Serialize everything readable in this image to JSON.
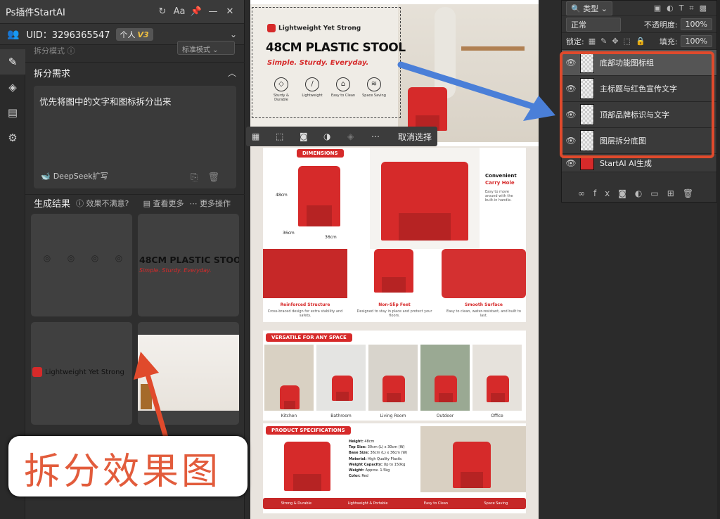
{
  "plugin": {
    "title": "Ps插件StartAI",
    "uid_label": "UID：3296365547",
    "plan": "个人",
    "version": "V3",
    "mode_label": "拆分模式",
    "mode_value": "标准模式",
    "req_section": "拆分需求",
    "req_text": "优先将图中的文字和图标拆分出来",
    "deepseek": "DeepSeek扩写",
    "result_title": "生成结果",
    "unsatisfied": "效果不满意?",
    "view_more": "查看更多",
    "more_ops": "更多操作",
    "tile_headline": "48CM PLASTIC STOOL",
    "tile_subline": "Simple. Sturdy. Everyday.",
    "tile_brand": "Lightweight Yet Strong"
  },
  "annotation": "拆分效果图",
  "canvas": {
    "brand": "Lightweight Yet Strong",
    "headline": "48CM PLASTIC STOOL",
    "subline": "Simple. Sturdy. Everyday.",
    "features": [
      "Sturdy & Durable",
      "Lightweight",
      "Easy to Clean",
      "Space Saving"
    ],
    "toolbar_label": "取消选择",
    "dimensions": "DIMENSIONS",
    "dim_h": "48cm",
    "dim_w1": "36cm",
    "dim_w2": "36cm",
    "convenient": "Convenient",
    "carry": "Carry Hole",
    "carry_desc": "Easy to move around with the built-in handle.",
    "f1_title": "Reinforced Structure",
    "f1_desc": "Cross-braced design for extra stability and safety.",
    "f2_title": "Non-Slip Feet",
    "f2_desc": "Designed to stay in place and protect your floors.",
    "f3_title": "Smooth Surface",
    "f3_desc": "Easy to clean, water-resistant, and built to last.",
    "versatile": "VERSATILE FOR ANY SPACE",
    "rooms": [
      "Kitchen",
      "Bathroom",
      "Living Room",
      "Outdoor",
      "Office"
    ],
    "specs_title": "PRODUCT SPECIFICATIONS",
    "specs": [
      {
        "k": "Height:",
        "v": "48cm"
      },
      {
        "k": "Top Size:",
        "v": "30cm (L) x 30cm (W)"
      },
      {
        "k": "Base Size:",
        "v": "36cm (L) x 36cm (W)"
      },
      {
        "k": "Material:",
        "v": "High Quality Plastic"
      },
      {
        "k": "Weight Capacity:",
        "v": "Up to 150kg"
      },
      {
        "k": "Weight:",
        "v": "Approx. 1.5kg"
      },
      {
        "k": "Color:",
        "v": "Red"
      }
    ],
    "bottom": [
      "Strong & Durable",
      "Lightweight & Portable",
      "Easy to Clean",
      "Space Saving"
    ]
  },
  "layers": {
    "filter": "类型",
    "blend": "正常",
    "opacity_label": "不透明度:",
    "opacity": "100%",
    "lock_label": "锁定:",
    "fill_label": "填充:",
    "fill": "100%",
    "items": [
      "底部功能图标组",
      "主标题与红色宣传文字",
      "顶部品牌标识与文字",
      "图层拆分底图",
      "StartAI AI生成"
    ]
  },
  "colors": {
    "accent": "#d62a2a",
    "highlight": "#e04a2c",
    "arrow_blue": "#4a7fd8"
  }
}
